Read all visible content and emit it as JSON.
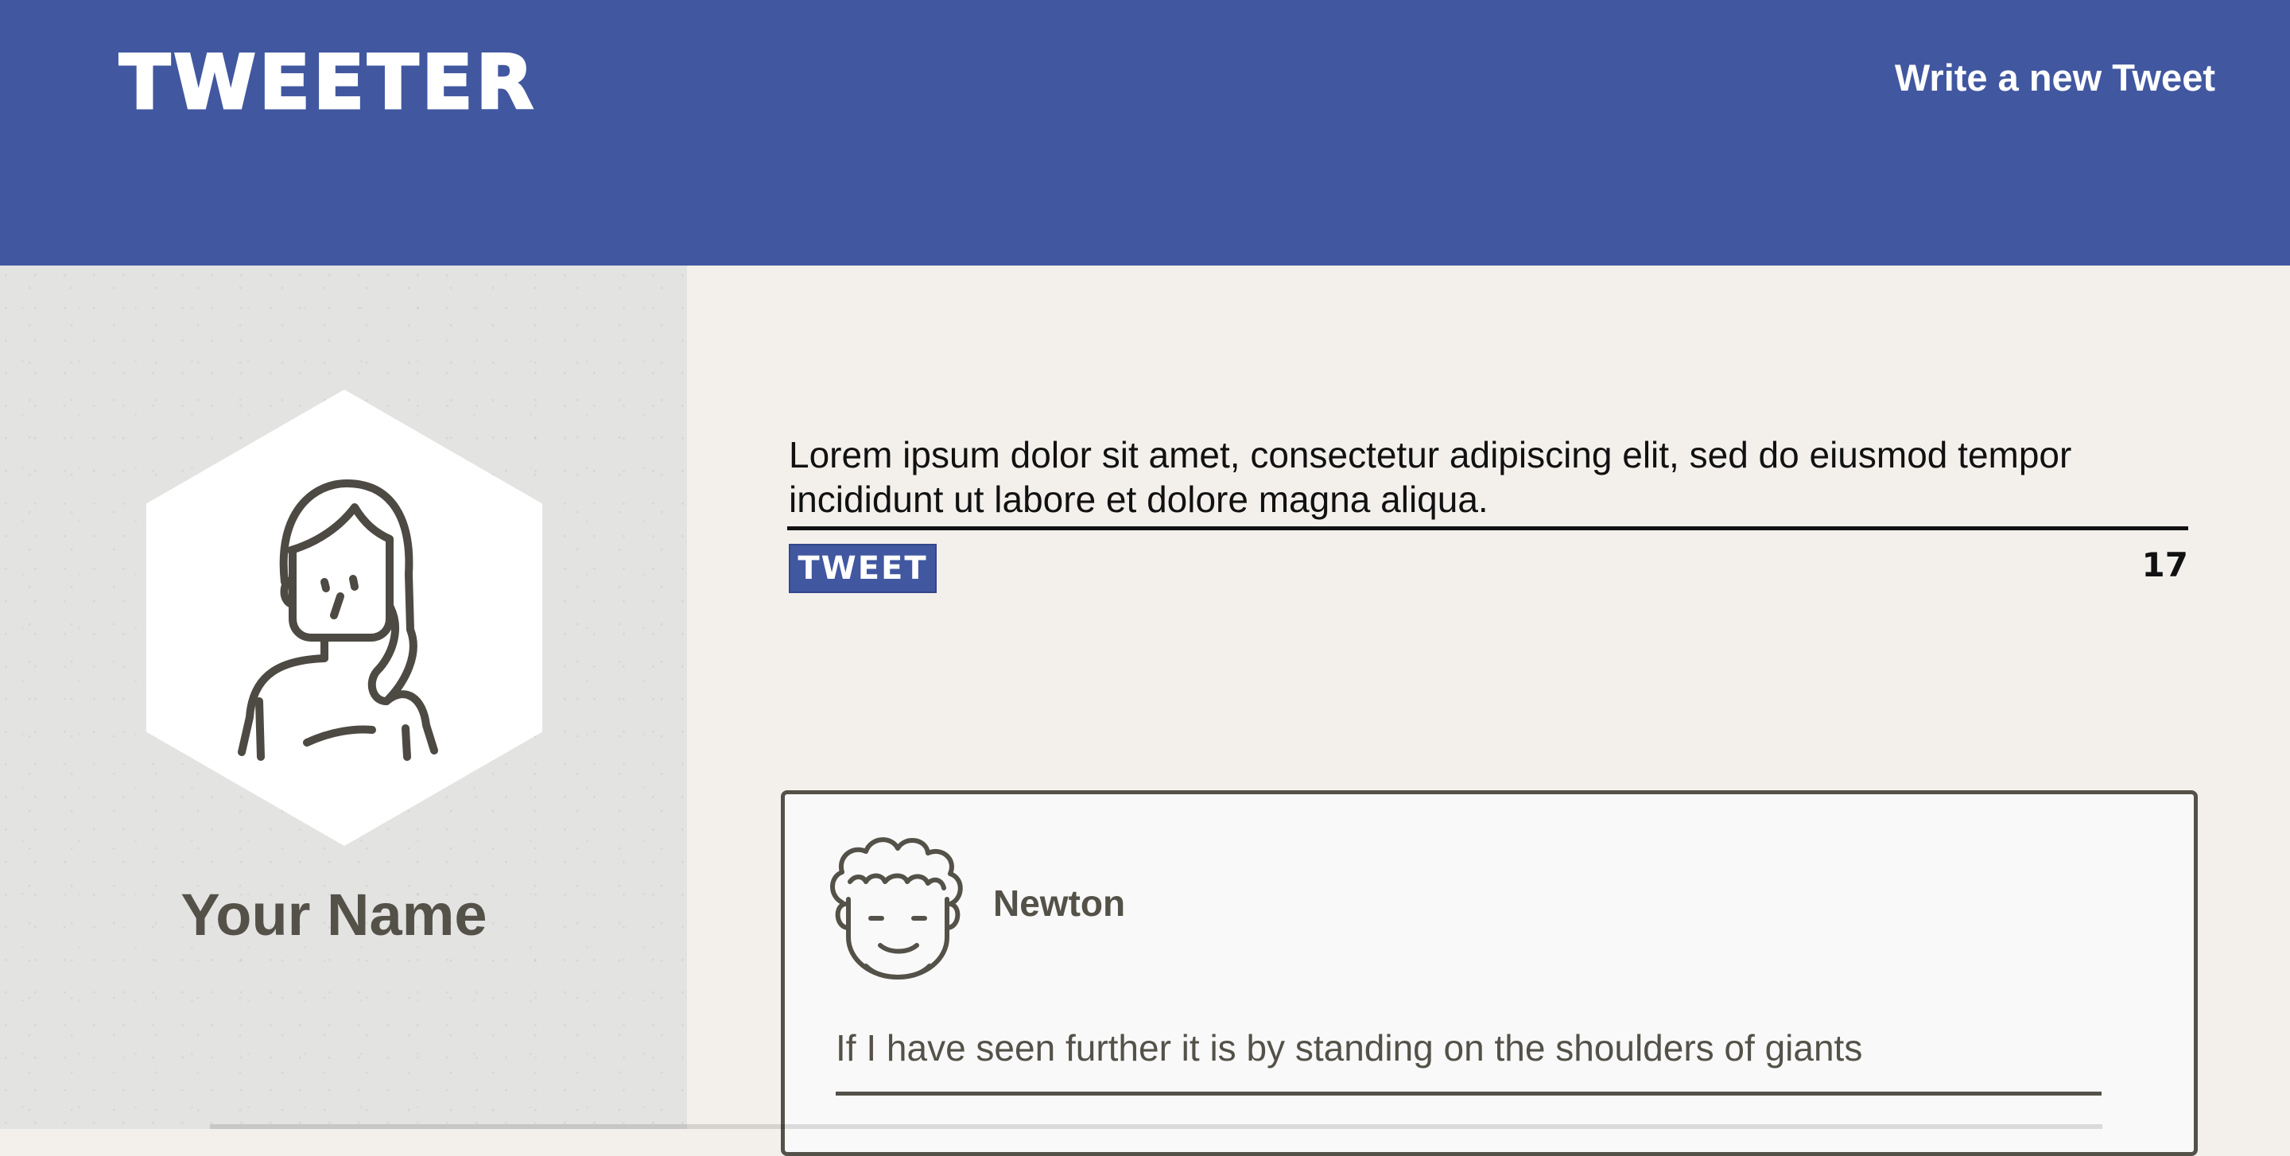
{
  "header": {
    "logo": "TWEETER",
    "compose_link": "Write a new Tweet"
  },
  "profile": {
    "name": "Your Name",
    "avatar_icon": "woman-avatar-icon"
  },
  "composer": {
    "text": "Lorem ipsum dolor sit amet, consectetur adipiscing elit, sed do eiusmod tempor incididunt ut labore et dolore magna aliqua.",
    "button_label": "TWEET",
    "char_count": "17"
  },
  "tweets": [
    {
      "author": "Newton",
      "avatar_icon": "curly-hair-man-avatar-icon",
      "text": "If I have seen further it is by standing on the shoulders of giants"
    }
  ],
  "colors": {
    "brand": "#4157a0",
    "sidebar_bg": "#e3e3e2",
    "main_bg": "#f3f0ec",
    "text_dark": "#545149"
  }
}
